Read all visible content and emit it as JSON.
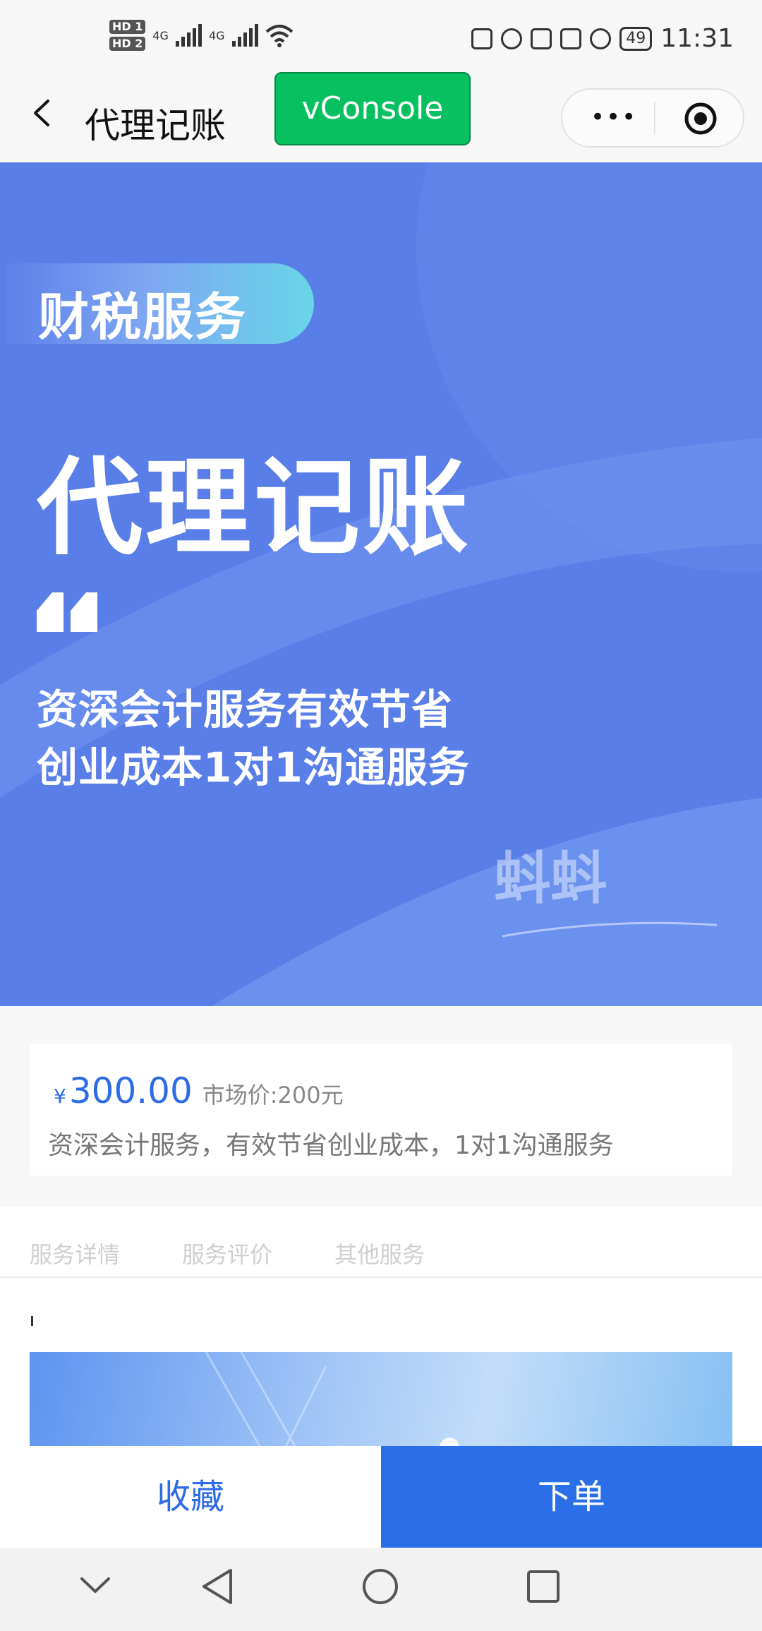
{
  "status_bar": {
    "sim1": "HD 1",
    "sim2": "HD 2",
    "network1": "4G",
    "network2": "4G",
    "battery": "49",
    "time": "11:31"
  },
  "nav": {
    "title": "代理记账",
    "vconsole_label": "vConsole"
  },
  "banner": {
    "tag": "财税服务",
    "title": "代理记账",
    "line1": "资深会计服务有效节省",
    "line2": "创业成本1对1沟通服务",
    "watermark": "蚪蚪"
  },
  "product": {
    "currency": "¥",
    "price": "300.00",
    "market_price": "市场价:200元",
    "description": "资深会计服务，有效节省创业成本，1对1沟通服务"
  },
  "tabs": [
    "服务详情",
    "服务评价",
    "其他服务"
  ],
  "actions": {
    "favorite": "收藏",
    "order": "下单"
  },
  "colors": {
    "accent": "#2b6fe8",
    "banner": "#5a7ee8",
    "vconsole": "#07c160"
  }
}
